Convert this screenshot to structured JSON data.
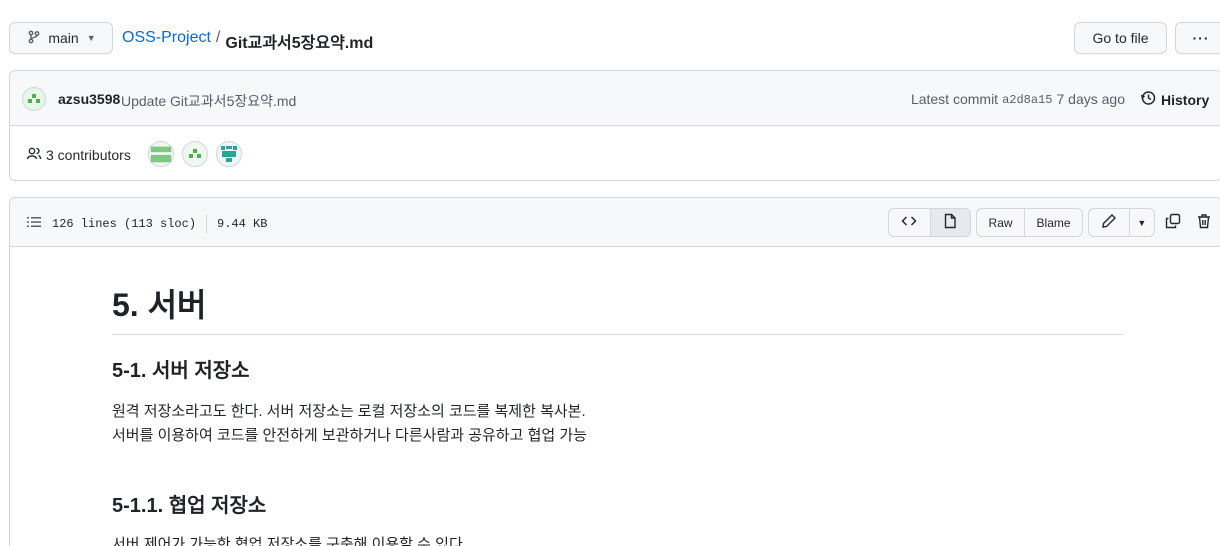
{
  "topbar": {
    "branch_label": "main",
    "repo_name": "OSS-Project",
    "separator": "/",
    "file_name": "Git교과서5장요약.md",
    "goto_file_label": "Go to file",
    "more_label": "···"
  },
  "commit": {
    "author": "azsu3598",
    "message": "Update Git교과서5장요약.md",
    "latest_label": "Latest commit",
    "sha": "a2d8a15",
    "time": "7 days ago",
    "history_label": "History"
  },
  "contributors": {
    "label": "3 contributors"
  },
  "file": {
    "lines": "126 lines (113 sloc)",
    "size": "9.44 KB",
    "raw_label": "Raw",
    "blame_label": "Blame"
  },
  "markdown": {
    "h1": "5. 서버",
    "h2": "5-1. 서버 저장소",
    "p1_line1": "원격 저장소라고도 한다. 서버 저장소는 로컬 저장소의 코드를 복제한 복사본.",
    "p1_line2": "서버를 이용하여 코드를 안전하게 보관하거나 다른사람과 공유하고 협업 가능",
    "h3": "5-1.1. 협업 저장소",
    "p2_partial": "서버 제어가 가능한 협업 저장소를 구축해 이용할 수 있다"
  },
  "colors": {
    "link": "#0969da",
    "border": "#d0d7de",
    "header_bg": "#f6f8fa",
    "avatar_green": "#4caf50"
  }
}
